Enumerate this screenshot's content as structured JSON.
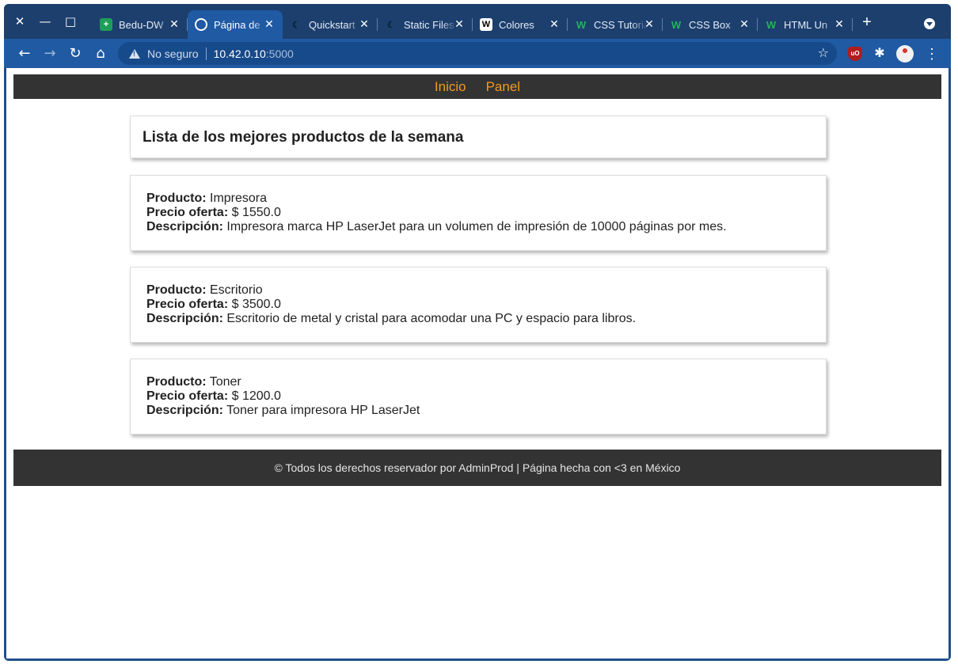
{
  "browser": {
    "tabs": [
      {
        "title": "Bedu-DW",
        "icon": "sheets-icon",
        "active": false
      },
      {
        "title": "Página de",
        "icon": "globe-icon",
        "active": true
      },
      {
        "title": "Quickstart",
        "icon": "moon-icon",
        "active": false
      },
      {
        "title": "Static Files",
        "icon": "moon-icon",
        "active": false
      },
      {
        "title": "Colores",
        "icon": "wikipedia-icon",
        "active": false
      },
      {
        "title": "CSS Tutorial",
        "icon": "w3schools-icon",
        "active": false
      },
      {
        "title": "CSS Box",
        "icon": "w3schools-icon",
        "active": false
      },
      {
        "title": "HTML Un",
        "icon": "w3schools-icon",
        "active": false
      }
    ],
    "address": {
      "security_label": "No seguro",
      "host": "10.42.0.10",
      "port": ":5000"
    }
  },
  "nav": {
    "links": [
      "Inicio",
      "Panel"
    ]
  },
  "main": {
    "heading": "Lista de los mejores productos de la semana",
    "labels": {
      "product": "Producto:",
      "price": "Precio oferta:",
      "description": "Descripción:"
    },
    "products": [
      {
        "name": "Impresora",
        "price": "$ 1550.0",
        "description": "Impresora marca HP LaserJet para un volumen de impresión de 10000 páginas por mes."
      },
      {
        "name": "Escritorio",
        "price": "$ 3500.0",
        "description": "Escritorio de metal y cristal para acomodar una PC y espacio para libros."
      },
      {
        "name": "Toner",
        "price": "$ 1200.0",
        "description": "Toner para impresora HP LaserJet"
      }
    ]
  },
  "footer": {
    "text": "© Todos los derechos reservador por AdminProd | Página hecha con <3 en México"
  },
  "colors": {
    "nav_bg": "#333333",
    "nav_link": "#f39a1c",
    "browser_frame": "#1f5aa3"
  }
}
